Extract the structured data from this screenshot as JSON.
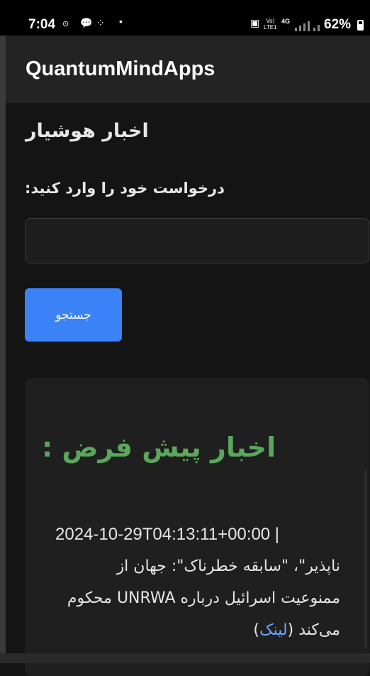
{
  "status_bar": {
    "time": "7:04",
    "net_top": "Vo)",
    "net_bottom": "LTE1",
    "lte": "4G",
    "battery": "62%"
  },
  "app": {
    "title": "QuantumMindApps"
  },
  "page": {
    "heading": "اخبار هوشیار",
    "prompt_label": "درخواست خود را وارد کنید:",
    "search_value": "",
    "search_button": "جستجو"
  },
  "news": {
    "heading": "اخبار پیش فرض :",
    "items": [
      {
        "timestamp": "2024-10-29T04:13:11+00:00 |",
        "text": "\"سابقه خطرناک\": جهان از ممنوعیت اسرائیل درباره UNRWA ناپذیر\"، \"",
        "text_full": "ناپذیر\"، \"سابقه خطرناک\": جهان از ممنوعیت اسرائیل درباره UNRWA محکوم می‌کند",
        "link_label": "لینک"
      }
    ]
  },
  "colors": {
    "accent_button": "#3b82f6",
    "news_heading": "#5aa75c",
    "link": "#6aa9ff",
    "background": "#141414"
  }
}
